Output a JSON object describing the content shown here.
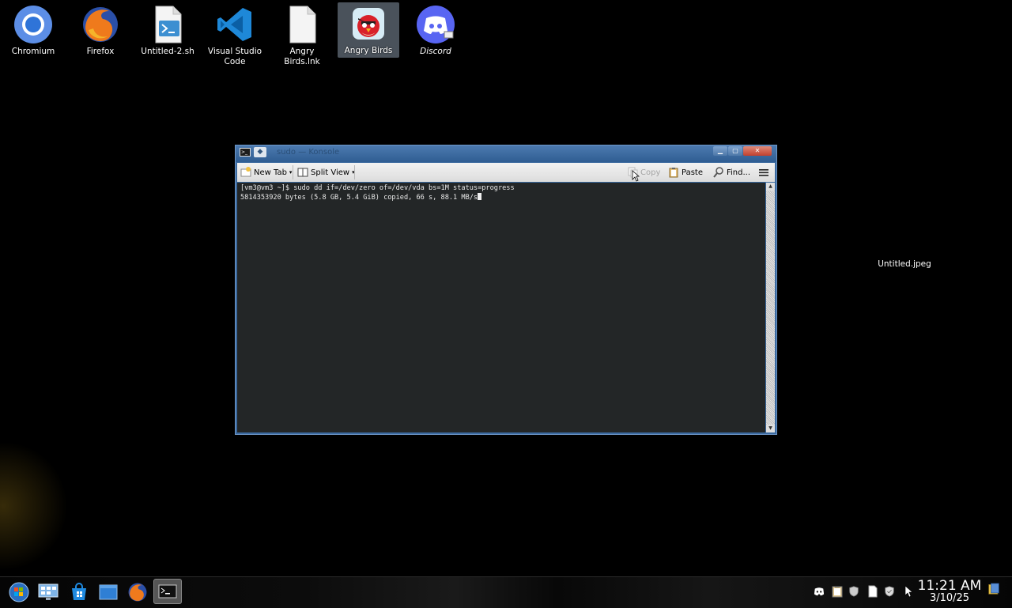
{
  "desktop": {
    "icons": [
      {
        "label": "Chromium",
        "icon": "chromium-icon"
      },
      {
        "label": "Firefox",
        "icon": "firefox-icon"
      },
      {
        "label": "Untitled-2.sh",
        "icon": "script-file-icon"
      },
      {
        "label": "Visual Studio Code",
        "icon": "vscode-icon"
      },
      {
        "label": "Angry Birds.lnk",
        "icon": "blank-file-icon"
      },
      {
        "label": "Angry Birds",
        "icon": "angry-birds-icon",
        "selected": true
      },
      {
        "label": "Discord",
        "icon": "discord-icon"
      }
    ],
    "loose_file_label": "Untitled.jpeg"
  },
  "window": {
    "title": "sudo — Konsole",
    "toolbar": {
      "new_tab": "New Tab",
      "split_view": "Split View",
      "copy": "Copy",
      "paste": "Paste",
      "find": "Find..."
    },
    "terminal": {
      "line1": "[vm3@vm3 ~]$ sudo dd if=/dev/zero of=/dev/vda bs=1M status=progress",
      "line2": "5814353920 bytes (5.8 GB, 5.4 GiB) copied, 66 s, 88.1 MB/s"
    }
  },
  "taskbar": {
    "apps": [
      "start-menu-icon",
      "system-settings-icon",
      "store-icon",
      "file-manager-icon",
      "firefox-icon",
      "konsole-icon"
    ],
    "active_app": "konsole-icon",
    "tray": [
      "discord-tray-icon",
      "clipboard-icon",
      "shield-icon",
      "document-icon",
      "shield-check-icon",
      "pointer-icon"
    ],
    "clock_time": "11:21 AM",
    "clock_date": "3/10/25"
  },
  "colors": {
    "window_frame": "#3b6aa0",
    "terminal_bg": "#232627",
    "desktop_bg": "#000000"
  }
}
